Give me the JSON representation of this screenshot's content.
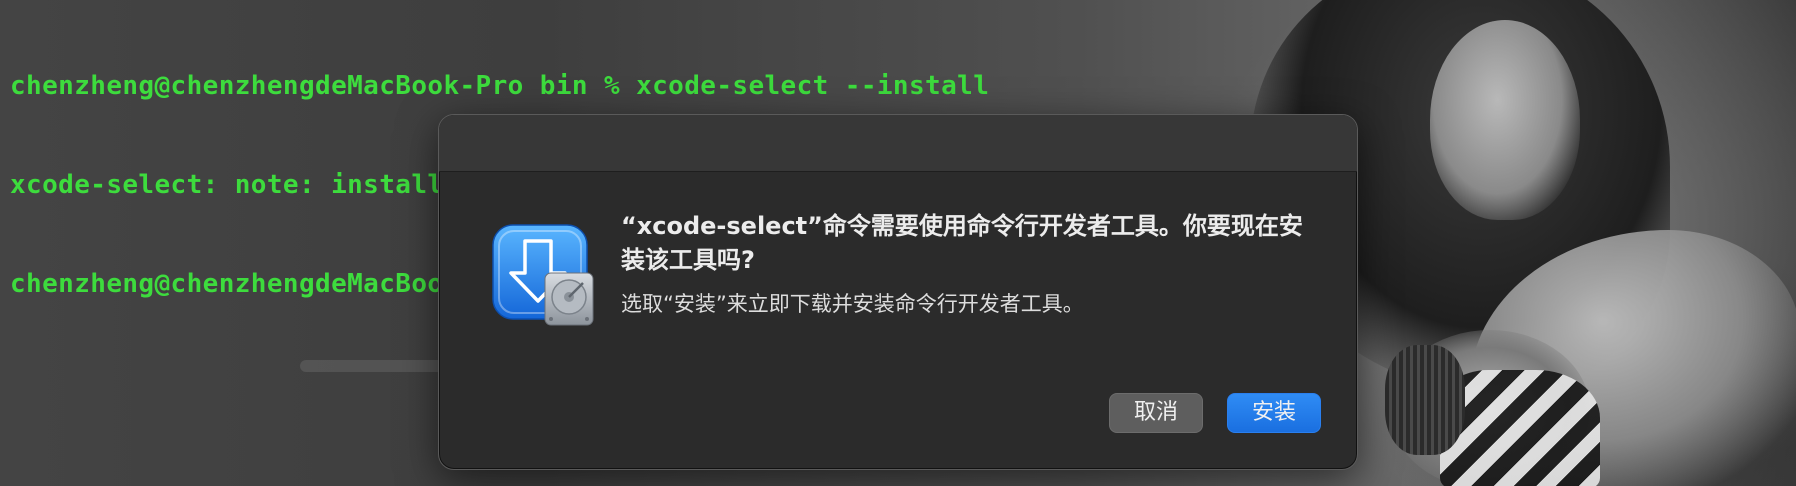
{
  "terminal": {
    "lines": [
      {
        "text": "chenzheng@chenzhengdeMacBook-Pro bin % xcode-select --install"
      },
      {
        "text": "xcode-select: note: install requested for command line developer tools"
      },
      {
        "prompt": "chenzheng@chenzhengdeMacBook-Pro bin % "
      }
    ],
    "text_color": "#3ddc3d",
    "cursor_color": "#f2e600"
  },
  "dialog": {
    "title": "“xcode-select”命令需要使用命令行开发者工具。你要现在安装该工具吗?",
    "message": "选取“安装”来立即下载并安装命令行开发者工具。",
    "icon": "xcode-download-drive-icon",
    "buttons": {
      "cancel_label": "取消",
      "install_label": "安装"
    },
    "accent_color": "#1a6fe0"
  }
}
